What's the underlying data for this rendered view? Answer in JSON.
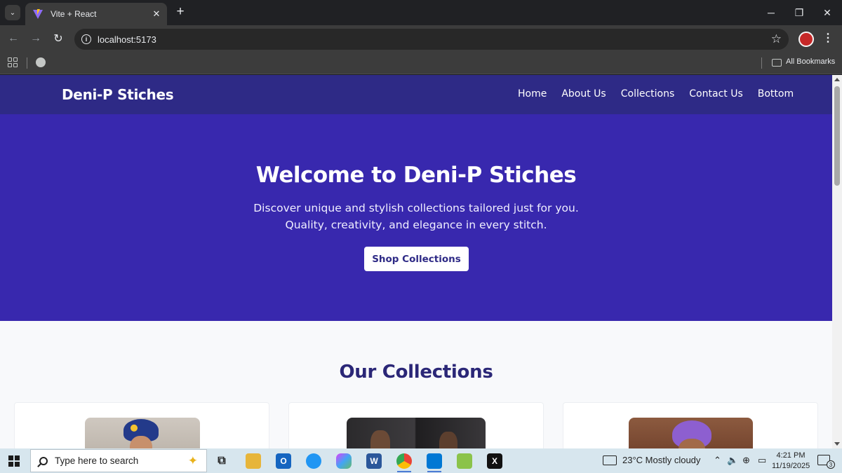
{
  "browser": {
    "tab_title": "Vite + React",
    "tab_close": "✕",
    "new_tab": "+",
    "tab_menu": "⌄",
    "url": "localhost:5173",
    "bookmarks_label": "All Bookmarks",
    "window_controls": {
      "minimize": "─",
      "restore": "❐",
      "close": "✕"
    },
    "nav": {
      "back": "←",
      "forward": "→",
      "reload": "↻"
    },
    "star": "☆",
    "menu": "⋮"
  },
  "site": {
    "brand": "Deni-P Stiches",
    "nav_links": [
      "Home",
      "About Us",
      "Collections",
      "Contact Us",
      "Bottom"
    ],
    "hero": {
      "title": "Welcome to Deni-P Stiches",
      "subtitle": "Discover unique and stylish collections tailored just for you. Quality, creativity, and elegance in every stitch.",
      "button": "Shop Collections"
    },
    "collections_title": "Our Collections",
    "colors": {
      "nav": "#2e2a86",
      "hero": "#3828ae",
      "accent": "#2b2777"
    }
  },
  "taskbar": {
    "search_placeholder": "Type here to search",
    "weather": "23°C  Mostly cloudy",
    "time": "4:21 PM",
    "date": "11/19/2025",
    "notification_count": "3",
    "word_icon_label": "W",
    "x_icon_label": "X"
  }
}
